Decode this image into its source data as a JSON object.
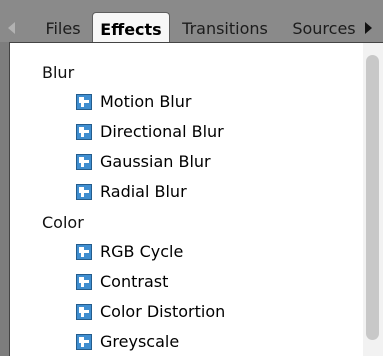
{
  "tabs": {
    "files": "Files",
    "effects": "Effects",
    "transitions": "Transitions",
    "sources": "Sources"
  },
  "groups": [
    {
      "label": "Blur",
      "items": [
        "Motion Blur",
        "Directional Blur",
        "Gaussian Blur",
        "Radial Blur"
      ]
    },
    {
      "label": "Color",
      "items": [
        "RGB Cycle",
        "Contrast",
        "Color Distortion",
        "Greyscale"
      ]
    }
  ],
  "colors": {
    "icon_fill": "#3f8ed0",
    "icon_border": "#245d8d",
    "selected_tab_bg": "#f7f7f7"
  },
  "icon_name": "effect-icon"
}
